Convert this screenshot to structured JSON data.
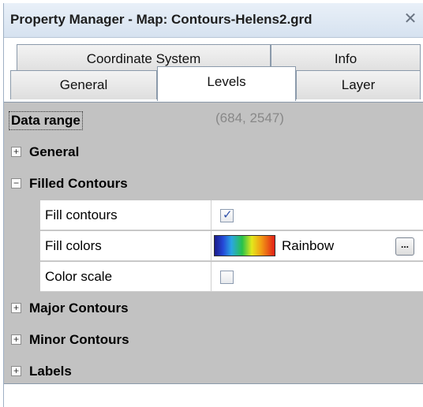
{
  "window": {
    "title": "Property Manager - Map: Contours-Helens2.grd",
    "close_glyph": "✕"
  },
  "tabs": {
    "row1": [
      {
        "label": "Coordinate System"
      },
      {
        "label": "Info"
      }
    ],
    "row2": [
      {
        "label": "General"
      },
      {
        "label": "Levels",
        "active": true
      },
      {
        "label": "Layer"
      }
    ]
  },
  "data_range": {
    "label": "Data range",
    "value": "(684, 2547)"
  },
  "categories": [
    {
      "name": "General",
      "expander": "+"
    },
    {
      "name": "Filled Contours",
      "expander": "−"
    },
    {
      "name": "Major Contours",
      "expander": "+"
    },
    {
      "name": "Minor Contours",
      "expander": "+"
    },
    {
      "name": "Labels",
      "expander": "+"
    }
  ],
  "filled_contours": {
    "fill_contours": {
      "label": "Fill contours",
      "checked": true,
      "check_glyph": "✓"
    },
    "fill_colors": {
      "label": "Fill colors",
      "value": "Rainbow",
      "button_label": "..."
    },
    "color_scale": {
      "label": "Color scale",
      "checked": false
    }
  },
  "colors": {
    "grid_background": "#c2c2c2",
    "title_bar": "#dce6f2",
    "checkmark": "#2d4fa8"
  }
}
